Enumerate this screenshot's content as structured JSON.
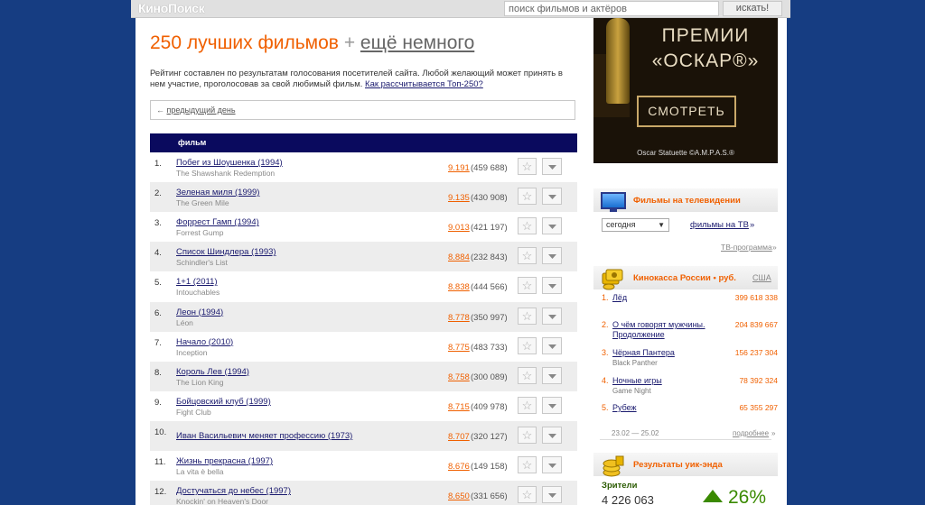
{
  "header": {
    "logo": "КиноПоиск",
    "search_placeholder": "поиск фильмов и актёров",
    "search_button": "искать!"
  },
  "main": {
    "title": "250 лучших фильмов",
    "title_plus": "+",
    "title_more": "ещё немного",
    "description": "Рейтинг составлен по результатам голосования посетителей сайта. Любой желающий может принять в нем участие, проголосовав за свой любимый фильм.",
    "description_link": "Как рассчитывается Топ-250?",
    "prev_day_arrow": "←",
    "prev_day": "предыдущий день",
    "table_header": "фильм",
    "movies": [
      {
        "num": "1.",
        "title": "Побег из Шоушенка (1994)",
        "orig": "The Shawshank Redemption",
        "rating": "9.191",
        "votes": "(459 688)"
      },
      {
        "num": "2.",
        "title": "Зеленая миля (1999)",
        "orig": "The Green Mile",
        "rating": "9.135",
        "votes": "(430 908)"
      },
      {
        "num": "3.",
        "title": "Форрест Гамп (1994)",
        "orig": "Forrest Gump",
        "rating": "9.013",
        "votes": "(421 197)"
      },
      {
        "num": "4.",
        "title": "Список Шиндлера (1993)",
        "orig": "Schindler's List",
        "rating": "8.884",
        "votes": "(232 843)"
      },
      {
        "num": "5.",
        "title": "1+1 (2011)",
        "orig": "Intouchables",
        "rating": "8.838",
        "votes": "(444 566)"
      },
      {
        "num": "6.",
        "title": "Леон (1994)",
        "orig": "Léon",
        "rating": "8.778",
        "votes": "(350 997)"
      },
      {
        "num": "7.",
        "title": "Начало (2010)",
        "orig": "Inception",
        "rating": "8.775",
        "votes": "(483 733)"
      },
      {
        "num": "8.",
        "title": "Король Лев (1994)",
        "orig": "The Lion King",
        "rating": "8.758",
        "votes": "(300 089)"
      },
      {
        "num": "9.",
        "title": "Бойцовский клуб (1999)",
        "orig": "Fight Club",
        "rating": "8.715",
        "votes": "(409 978)"
      },
      {
        "num": "10.",
        "title": "Иван Васильевич меняет профессию (1973)",
        "orig": "",
        "rating": "8.707",
        "votes": "(320 127)"
      },
      {
        "num": "11.",
        "title": "Жизнь прекрасна (1997)",
        "orig": "La vita è bella",
        "rating": "8.676",
        "votes": "(149 158)"
      },
      {
        "num": "12.",
        "title": "Достучаться до небес (1997)",
        "orig": "Knockin' on Heaven's Door",
        "rating": "8.650",
        "votes": "(331 656)"
      }
    ]
  },
  "sidebar": {
    "oscar_line1": "ПРЕМИИ",
    "oscar_line2": "«ОСКАР®»",
    "oscar_button": "СМОТРЕТЬ",
    "oscar_credit": "Oscar Statuette ©A.M.P.A.S.®",
    "tv_title": "Фильмы на телевидении",
    "tv_day": "сегодня",
    "tv_day_caret": "▼",
    "tv_films_link": "фильмы на ТВ",
    "tv_films_arrow": "»",
    "tv_program": "ТВ-программа",
    "tv_program_arrow": "»",
    "box_office_title": "Кинокасса России • руб.",
    "box_office_usa": "США",
    "box_office": [
      {
        "num": "1.",
        "title": "Лёд",
        "orig": "",
        "money": "399 618 338"
      },
      {
        "num": "2.",
        "title": "О чём говорят мужчины. Продолжение",
        "orig": "",
        "money": "204 839 667"
      },
      {
        "num": "3.",
        "title": "Чёрная Пантера",
        "orig": "Black Panther",
        "money": "156 237 304"
      },
      {
        "num": "4.",
        "title": "Ночные игры",
        "orig": "Game Night",
        "money": "78 392 324"
      },
      {
        "num": "5.",
        "title": "Рубеж",
        "orig": "",
        "money": "65 355 297"
      }
    ],
    "box_office_dates": "23.02 — 25.02",
    "box_office_more": "подробнее",
    "box_office_more_arrow": "»",
    "weekend_title": "Результаты уик-энда",
    "viewers_label": "Зрители",
    "viewers_count": "4 226 063",
    "viewers_change": "26%"
  },
  "colors": {
    "accent": "#f06000",
    "link": "#1a1a6e",
    "header_bar": "#0a0a5e",
    "background": "#163d82",
    "trend_up": "#3a8a00"
  }
}
